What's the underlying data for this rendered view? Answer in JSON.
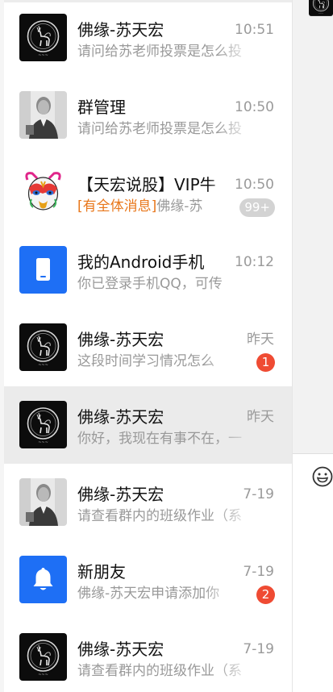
{
  "conversations": [
    {
      "name": "佛缘-苏天宏",
      "time": "10:51",
      "preview": "请问给苏老师投票是怎么投",
      "avatar": "deer-logo-icon"
    },
    {
      "name": "群管理",
      "time": "10:50",
      "preview": "请问给苏老师投票是怎么投",
      "avatar": "person-photo-icon"
    },
    {
      "name": "【天宏说股】VIP牛",
      "time": "10:50",
      "mention": "[有全体消息]",
      "preview": "佛缘-苏",
      "badge": "99+",
      "avatar": "opera-mask-icon"
    },
    {
      "name": "我的Android手机",
      "time": "10:12",
      "preview": "你已登录手机QQ，可传",
      "avatar": "phone-icon"
    },
    {
      "name": "佛缘-苏天宏",
      "time": "昨天",
      "preview": "这段时间学习情况怎么",
      "badge": "1",
      "avatar": "deer-logo-icon"
    },
    {
      "name": "佛缘-苏天宏",
      "time": "昨天",
      "preview": "你好，我现在有事不在，一",
      "avatar": "deer-logo-icon",
      "selected": true
    },
    {
      "name": "佛缘-苏天宏",
      "time": "7-19",
      "preview": "请查看群内的班级作业（系",
      "avatar": "person-photo-icon"
    },
    {
      "name": "新朋友",
      "time": "7-19",
      "preview": "佛缘-苏天宏申请添加你",
      "badge": "2",
      "avatar": "bell-icon"
    },
    {
      "name": "佛缘-苏天宏",
      "time": "7-19",
      "preview": "请查看群内的班级作业（系",
      "avatar": "deer-logo-icon"
    }
  ],
  "colors": {
    "accent_blue": "#1e6ff5",
    "badge_red": "#ef4b33",
    "badge_gray": "#d3d3d3",
    "mention_orange": "#e8771b",
    "selected_bg": "#ebebeb"
  },
  "right_pane": {
    "emoji_icon": "smiley-face-icon"
  }
}
